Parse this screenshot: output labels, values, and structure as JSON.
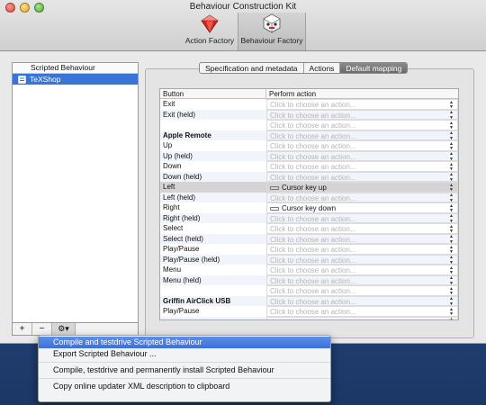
{
  "window": {
    "title": "Behaviour Construction Kit"
  },
  "toolbar": {
    "action_factory": {
      "label": "Action Factory",
      "icon": "ruby-gem-icon"
    },
    "behaviour_factory": {
      "label": "Behaviour Factory",
      "icon": "cube-robot-icon",
      "selected": true
    }
  },
  "sidebar": {
    "header": "Scripted Behaviour",
    "items": [
      {
        "label": "TeXShop",
        "selected": true
      }
    ],
    "add_label": "+",
    "remove_label": "−",
    "gear_label": "⚙▾"
  },
  "tabs": [
    {
      "label": "Specification and metadata",
      "active": false
    },
    {
      "label": "Actions",
      "active": false
    },
    {
      "label": "Default mapping",
      "active": true
    }
  ],
  "mapping_table": {
    "columns": [
      "Button",
      "Perform action"
    ],
    "placeholder": "Click to choose an action...",
    "rows": [
      {
        "button": "Exit",
        "action": ""
      },
      {
        "button": "Exit (held)",
        "action": ""
      },
      {
        "button": "",
        "action": ""
      },
      {
        "button": "Apple Remote",
        "action": "",
        "group": true
      },
      {
        "button": "Up",
        "action": ""
      },
      {
        "button": "Up (held)",
        "action": ""
      },
      {
        "button": "Down",
        "action": ""
      },
      {
        "button": "Down (held)",
        "action": ""
      },
      {
        "button": "Left",
        "action": "Cursor key up",
        "highlight": true
      },
      {
        "button": "Left (held)",
        "action": ""
      },
      {
        "button": "Right",
        "action": "Cursor key down"
      },
      {
        "button": "Right (held)",
        "action": ""
      },
      {
        "button": "Select",
        "action": ""
      },
      {
        "button": "Select (held)",
        "action": ""
      },
      {
        "button": "Play/Pause",
        "action": ""
      },
      {
        "button": "Play/Pause (held)",
        "action": ""
      },
      {
        "button": "Menu",
        "action": ""
      },
      {
        "button": "Menu (held)",
        "action": ""
      },
      {
        "button": "",
        "action": ""
      },
      {
        "button": "Griffin AirClick USB",
        "action": "",
        "group": true
      },
      {
        "button": "Play/Pause",
        "action": ""
      },
      {
        "button": "",
        "action": ""
      }
    ]
  },
  "context_menu": {
    "items": [
      {
        "label": "Compile and testdrive Scripted Behaviour",
        "hover": true
      },
      {
        "label": "Export Scripted Behaviour ..."
      },
      {
        "separator": true
      },
      {
        "label": "Compile, testdrive and permanently install Scripted Behaviour"
      },
      {
        "separator": true
      },
      {
        "label": "Copy online updater XML description to clipboard"
      }
    ]
  },
  "colors": {
    "selection": "#3875d7",
    "menu_hover": "#3c70d8"
  }
}
